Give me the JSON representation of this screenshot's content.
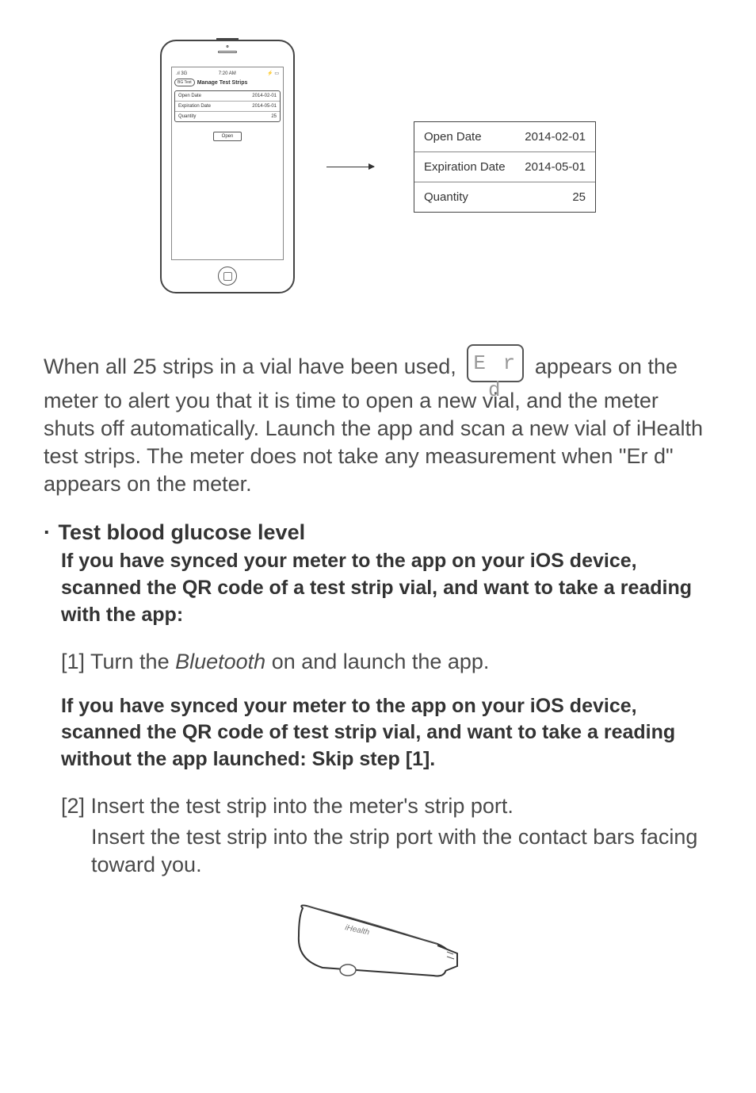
{
  "phone": {
    "status_left": "3G",
    "status_signal": "▮▮▮▮",
    "status_time": "7:20 AM",
    "status_battery": "⚡",
    "back_button": "BG Test",
    "screen_title": "Manage Test Strips",
    "rows": [
      {
        "label": "Open Date",
        "value": "2014-02-01"
      },
      {
        "label": "Expiration Date",
        "value": "2014-05-01"
      },
      {
        "label": "Quantity",
        "value": "25"
      }
    ],
    "open_button": "Open"
  },
  "detail_card": {
    "rows": [
      {
        "label": "Open Date",
        "value": "2014-02-01"
      },
      {
        "label": "Expiration Date",
        "value": "2014-05-01"
      },
      {
        "label": "Quantity",
        "value": "25"
      }
    ]
  },
  "lcd_code": "E r d",
  "para1_a": "When all 25 strips in a vial have been used,",
  "para1_b": "appears on the meter to alert you that it is time to open a new vial, and the meter shuts off automatically. Launch the app and scan a new vial of iHealth test strips. The meter does not take any measurement when \"Er d\" appears on the meter.",
  "heading_bullet": "·",
  "heading_text": "Test blood glucose level",
  "bold1": "If you have synced your meter to the app on your iOS device, scanned the QR code of a test strip vial, and want to take a reading with the app:",
  "step1_a": "[1] Turn the ",
  "step1_italic": "Bluetooth",
  "step1_b": " on and launch the app.",
  "bold2": "If you have synced your meter to the app on your iOS device, scanned the QR code of test strip vial, and want to take a reading without the app launched: Skip step [1].",
  "step2_a": "[2] Insert the test strip into the meter's strip port.",
  "step2_b": "Insert the test strip into the strip port with the contact bars facing toward you.",
  "meter_brand": "iHealth"
}
